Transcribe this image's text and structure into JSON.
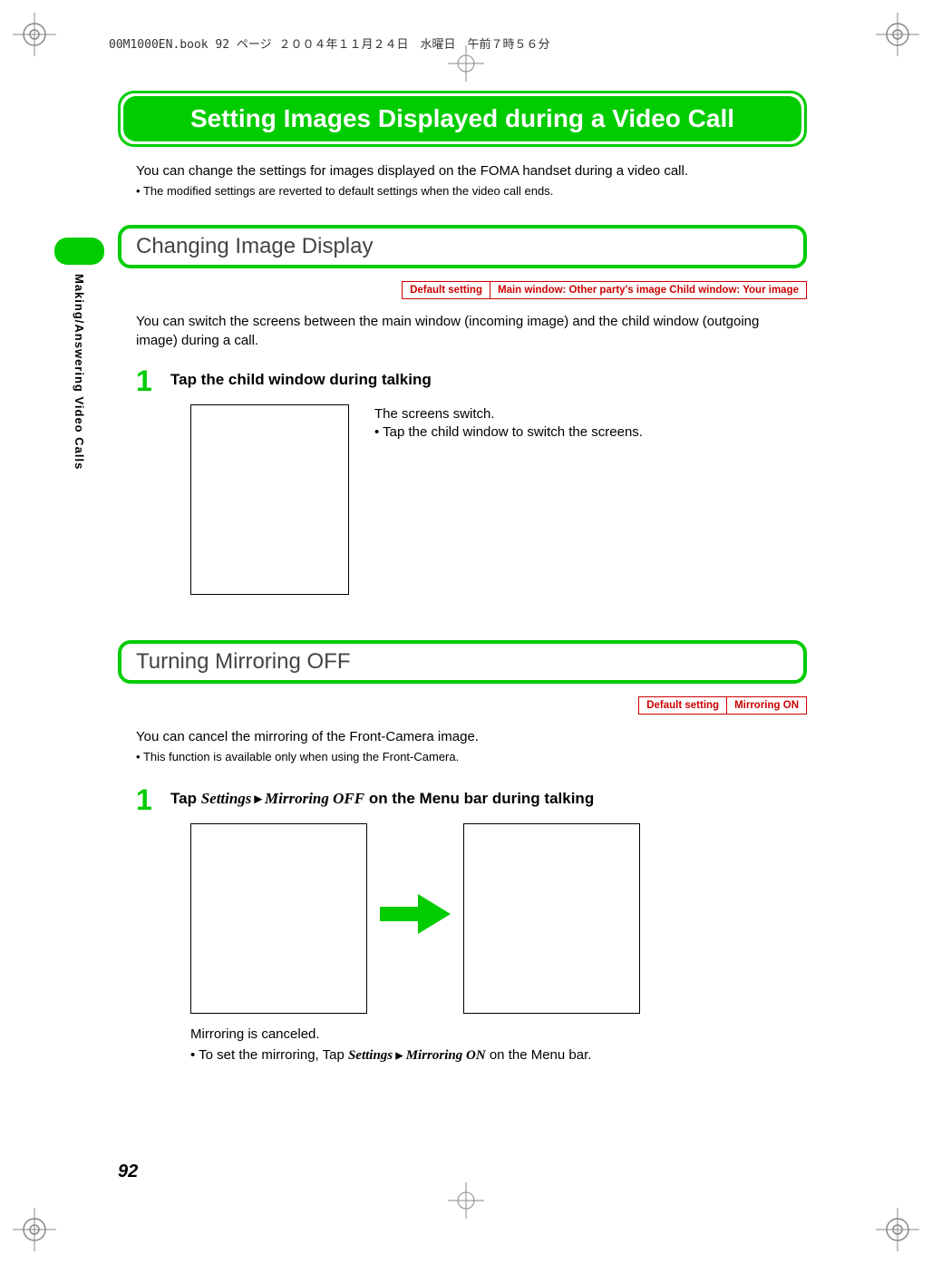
{
  "header_line": "00M1000EN.book  92 ページ  ２００４年１１月２４日　水曜日　午前７時５６分",
  "sidebar": "Making/Answering Video Calls",
  "title": "Setting Images Displayed during a Video Call",
  "intro": "You can change the settings for images displayed on the FOMA handset during a video call.",
  "intro_bullet": "The modified settings are reverted to default settings when the video call ends.",
  "section1": {
    "heading": "Changing Image Display",
    "default_label": "Default setting",
    "default_value": "Main window: Other party's image    Child window: Your image",
    "body": "You can switch the screens between the main window (incoming image) and the child window (outgoing image) during a call.",
    "step_num": "1",
    "step_title": "Tap the child window during talking",
    "fig_line1": "The screens switch.",
    "fig_bullet": "Tap the child window to switch the screens."
  },
  "section2": {
    "heading": "Turning Mirroring OFF",
    "default_label": "Default setting",
    "default_value": "Mirroring ON",
    "body": "You can cancel the mirroring of the Front-Camera image.",
    "body_note": "This function is available only when using the Front-Camera.",
    "step_num": "1",
    "step_prefix": "Tap ",
    "step_it1": "Settings",
    "step_tri": " ▶ ",
    "step_it2": "Mirroring OFF",
    "step_suffix": " on the Menu bar during talking",
    "after_text": "Mirroring is canceled.",
    "after_prefix": "To set the mirroring, Tap ",
    "after_it1": "Settings",
    "after_tri": " ▶ ",
    "after_it2": "Mirroring ON",
    "after_suffix": " on the Menu bar."
  },
  "page_number": "92"
}
